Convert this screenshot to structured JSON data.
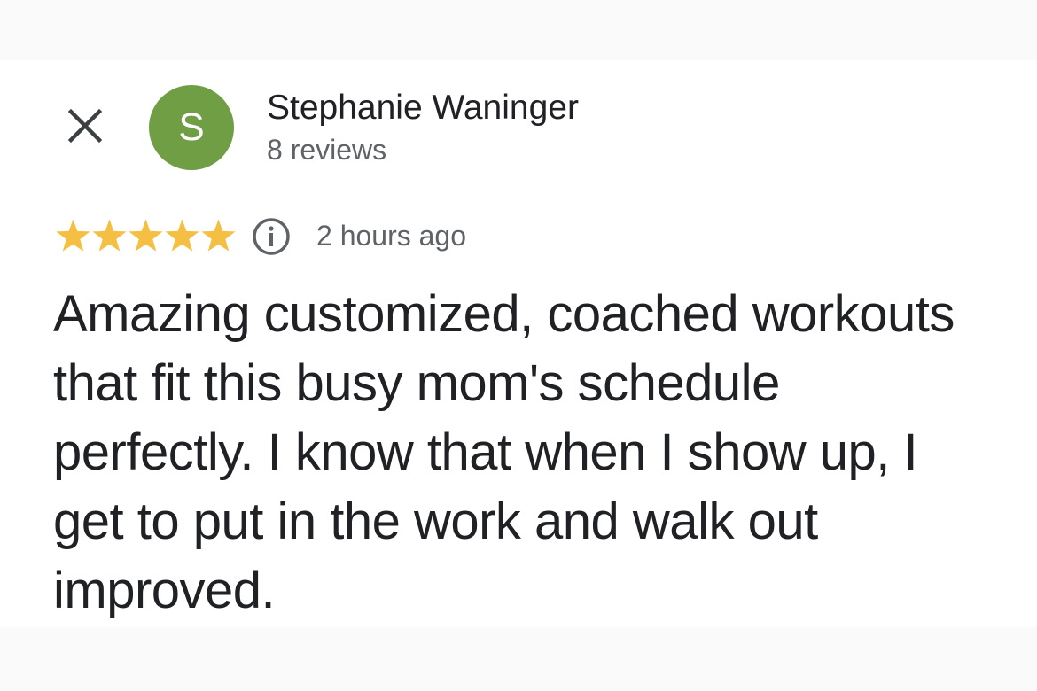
{
  "review": {
    "author_name": "Stephanie Waninger",
    "author_initial": "S",
    "author_review_count": "8 reviews",
    "rating": 5,
    "rating_max": 5,
    "timestamp": "2 hours ago",
    "text": "Amazing customized, coached workouts that fit this busy mom's schedule perfectly. I know that when I show up, I get to put in the work and walk out improved."
  },
  "icons": {
    "close": "close-icon",
    "info": "info-icon",
    "star": "star-icon"
  },
  "colors": {
    "avatar_bg": "#6f9e45",
    "star_fill": "#f4bf42",
    "icon_gray": "#5f6368",
    "text_primary": "#202124",
    "text_secondary": "#5f6368"
  }
}
